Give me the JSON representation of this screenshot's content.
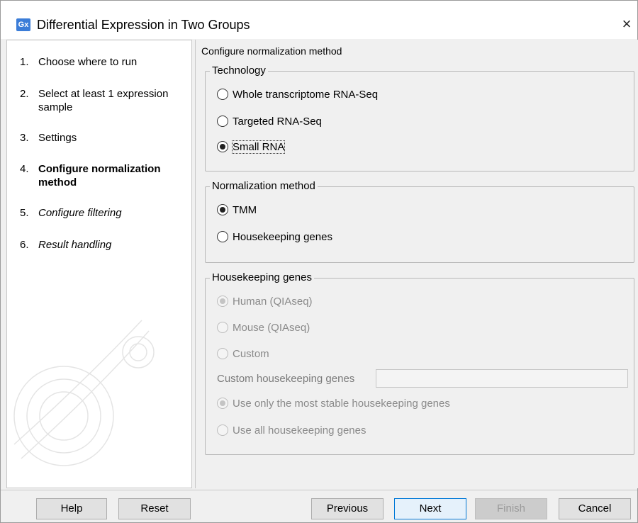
{
  "window": {
    "icon_text": "Gx",
    "title": "Differential Expression in Two Groups",
    "close_glyph": "×"
  },
  "steps": [
    {
      "num": "1.",
      "label": "Choose where to run",
      "state": "done"
    },
    {
      "num": "2.",
      "label": "Select at least 1 expression sample",
      "state": "done"
    },
    {
      "num": "3.",
      "label": "Settings",
      "state": "done"
    },
    {
      "num": "4.",
      "label": "Configure normalization method",
      "state": "active"
    },
    {
      "num": "5.",
      "label": "Configure filtering",
      "state": "future"
    },
    {
      "num": "6.",
      "label": "Result handling",
      "state": "future"
    }
  ],
  "content": {
    "section_title": "Configure normalization method",
    "technology": {
      "title": "Technology",
      "options": [
        {
          "label": "Whole transcriptome RNA-Seq",
          "checked": false
        },
        {
          "label": "Targeted RNA-Seq",
          "checked": false
        },
        {
          "label": "Small RNA",
          "checked": true
        }
      ]
    },
    "normalization": {
      "title": "Normalization method",
      "options": [
        {
          "label": "TMM",
          "checked": true
        },
        {
          "label": "Housekeeping genes",
          "checked": false
        }
      ]
    },
    "housekeeping": {
      "title": "Housekeeping genes",
      "options": [
        {
          "label": "Human (QIAseq)",
          "checked": true
        },
        {
          "label": "Mouse (QIAseq)",
          "checked": false
        },
        {
          "label": "Custom",
          "checked": false
        }
      ],
      "custom_label": "Custom housekeeping genes",
      "custom_value": "",
      "stability_options": [
        {
          "label": "Use only the most stable housekeeping genes",
          "checked": true
        },
        {
          "label": "Use all housekeeping genes",
          "checked": false
        }
      ]
    }
  },
  "buttons": {
    "help": "Help",
    "reset": "Reset",
    "previous": "Previous",
    "next": "Next",
    "finish": "Finish",
    "cancel": "Cancel"
  }
}
